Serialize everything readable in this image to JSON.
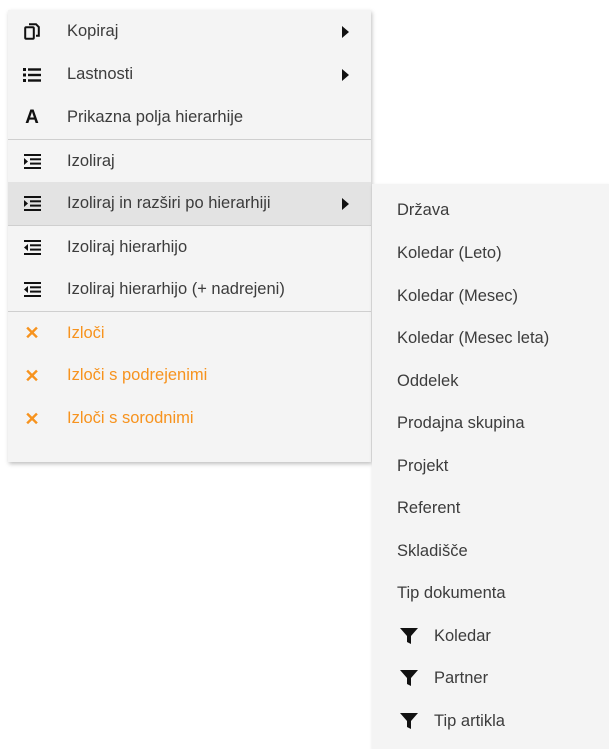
{
  "menu": {
    "items": [
      {
        "label": "Kopiraj",
        "icon": "copy-icon"
      },
      {
        "label": "Lastnosti",
        "icon": "list-icon"
      },
      {
        "label": "Prikazna polja hierarhije",
        "icon": "font-icon"
      },
      {
        "label": "Izoliraj",
        "icon": "indent-icon"
      },
      {
        "label": "Izoliraj in razširi po hierarhiji",
        "icon": "indent-icon"
      },
      {
        "label": "Izoliraj hierarhijo",
        "icon": "outdent-icon"
      },
      {
        "label": "Izoliraj hierarhijo (+ nadrejeni)",
        "icon": "outdent-icon"
      },
      {
        "label": "Izloči",
        "icon": "close-icon"
      },
      {
        "label": "Izloči s podrejenimi",
        "icon": "close-icon"
      },
      {
        "label": "Izloči s sorodnimi",
        "icon": "close-icon"
      }
    ]
  },
  "submenu": {
    "items": [
      {
        "label": "Država"
      },
      {
        "label": "Koledar (Leto)"
      },
      {
        "label": "Koledar (Mesec)"
      },
      {
        "label": "Koledar (Mesec leta)"
      },
      {
        "label": "Oddelek"
      },
      {
        "label": "Prodajna skupina"
      },
      {
        "label": "Projekt"
      },
      {
        "label": "Referent"
      },
      {
        "label": "Skladišče"
      },
      {
        "label": "Tip dokumenta"
      },
      {
        "label": "Koledar",
        "icon": "filter-icon"
      },
      {
        "label": "Partner",
        "icon": "filter-icon"
      },
      {
        "label": "Tip artikla",
        "icon": "filter-icon"
      }
    ]
  },
  "colors": {
    "accent": "#f7931e",
    "menu_bg": "#f4f4f4",
    "highlight_bg": "#e3e3e3",
    "text": "#3c3c3c"
  }
}
